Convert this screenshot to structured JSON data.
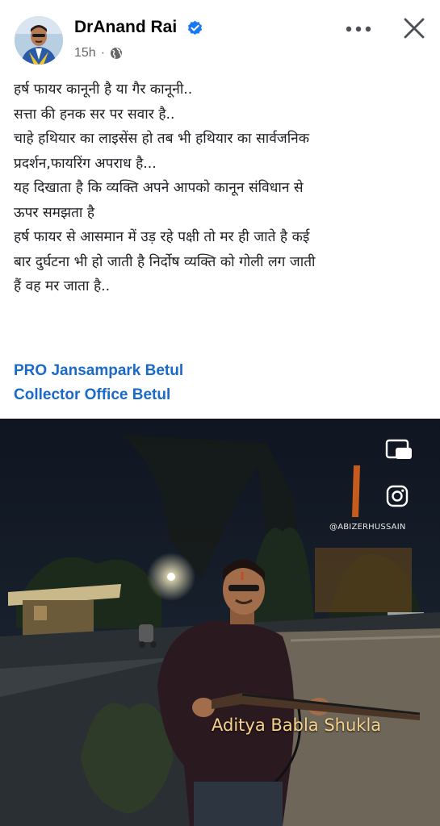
{
  "post": {
    "author": "DrAnand Rai",
    "timestamp": "15h",
    "dot": "·",
    "privacy_icon": "globe-icon",
    "verified_icon": "verified-badge-icon",
    "more_icon": "more-horizontal-icon",
    "close_icon": "close-icon"
  },
  "body": {
    "lines": [
      "हर्ष फायर कानूनी है या गैर कानूनी..",
      "सत्ता की हनक सर पर सवार है..",
      "चाहे हथियार का लाइसेंस हो तब भी हथियार का सार्वजनिक",
      "प्रदर्शन,फायरिंग अपराध है...",
      "यह दिखाता है कि व्यक्ति अपने आपको कानून संविधान से",
      "ऊपर समझता है",
      "हर्ष फायर से आसमान में उड़ रहे पक्षी तो मर ही जाते है कई",
      "बार दुर्घटना भी हो जाती है निर्दोष व्यक्ति को गोली लग जाती",
      "हैं वह मर जाता है.."
    ]
  },
  "tags": [
    "PRO Jansampark Betul",
    "Collector Office Betul"
  ],
  "video": {
    "watermark": "@ABIZERHUSSAIN",
    "caption": "Aditya Babla Shukla",
    "pip_icon": "picture-in-picture-icon",
    "instagram_icon": "instagram-icon"
  },
  "colors": {
    "link": "#1b6ac9",
    "verified": "#1877f2",
    "secondary_text": "#65676b",
    "caption": "#f7d28a"
  }
}
